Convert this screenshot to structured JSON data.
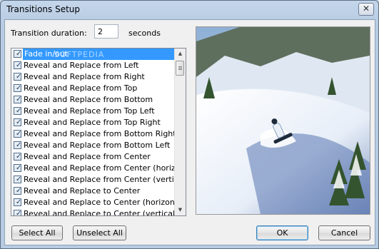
{
  "window": {
    "title": "Transitions Setup",
    "close_glyph": "✕"
  },
  "duration": {
    "label": "Transition duration:",
    "value": "2",
    "unit": "seconds"
  },
  "list": {
    "watermark": "SOFTPEDIA",
    "items": [
      {
        "label": "Fade in/out",
        "checked": true,
        "selected": true
      },
      {
        "label": "Reveal and Replace from Left",
        "checked": true
      },
      {
        "label": "Reveal and Replace from Right",
        "checked": true
      },
      {
        "label": "Reveal and Replace from Top",
        "checked": true
      },
      {
        "label": "Reveal and Replace from Bottom",
        "checked": true
      },
      {
        "label": "Reveal and Replace from Top Left",
        "checked": true
      },
      {
        "label": "Reveal and Replace from Top Right",
        "checked": true
      },
      {
        "label": "Reveal and Replace from Bottom Right",
        "checked": true
      },
      {
        "label": "Reveal and Replace from Bottom Left",
        "checked": true
      },
      {
        "label": "Reveal and Replace from Center",
        "checked": true
      },
      {
        "label": "Reveal and Replace from Center (horizontal",
        "checked": true
      },
      {
        "label": "Reveal and Replace from Center (vertical)",
        "checked": true
      },
      {
        "label": "Reveal and Replace to Center",
        "checked": true
      },
      {
        "label": "Reveal and Replace to Center (horizontal)",
        "checked": true
      },
      {
        "label": "Reveal and Replace to Center (vertical)",
        "checked": true
      }
    ],
    "check_glyph": "✓"
  },
  "preview": {
    "icon": "snowboarder-preview-image"
  },
  "buttons": {
    "select_all": "Select All",
    "unselect_all": "Unselect All",
    "ok": "OK",
    "cancel": "Cancel"
  }
}
